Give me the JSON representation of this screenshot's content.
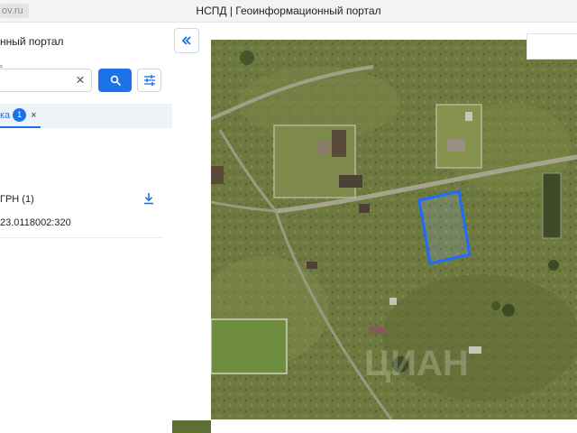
{
  "browser": {
    "url_fragment": "ov.ru",
    "window_title": "НСПД | Геоинформационный портал"
  },
  "panel": {
    "portal_name": "нный портал",
    "field_label": "е",
    "search": {
      "value": "",
      "placeholder": ""
    },
    "tab": {
      "label": "ка",
      "count": "1",
      "close": "×"
    },
    "results": {
      "group_label": "ГРН (1)",
      "items": [
        "23.0118002:320"
      ]
    }
  },
  "map": {
    "watermark": "ЦИАН"
  },
  "colors": {
    "accent": "#1a73e8",
    "highlight_plot": "#1e6cff"
  },
  "icons": [
    "search-icon",
    "filter-icon",
    "close-icon",
    "download-icon",
    "double-chevron-left-icon"
  ]
}
